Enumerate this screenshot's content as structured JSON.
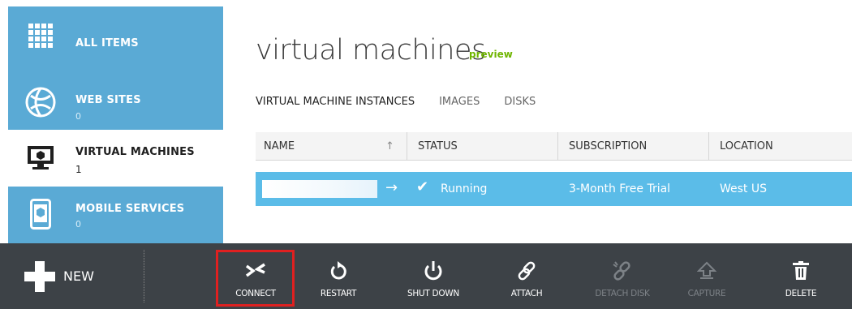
{
  "sidebar": {
    "items": [
      {
        "label": "ALL ITEMS",
        "count": "",
        "icon": "grid-icon"
      },
      {
        "label": "WEB SITES",
        "count": "0",
        "icon": "globe-icon"
      },
      {
        "label": "VIRTUAL MACHINES",
        "count": "1",
        "icon": "monitor-icon"
      },
      {
        "label": "MOBILE SERVICES",
        "count": "0",
        "icon": "mobile-icon"
      }
    ],
    "colors": {
      "nav_bg": "#5aaad5",
      "active_bg": "#ffffff"
    }
  },
  "main": {
    "title": "virtual machines",
    "badge": "preview",
    "tabs": [
      {
        "label": "VIRTUAL MACHINE INSTANCES"
      },
      {
        "label": "IMAGES"
      },
      {
        "label": "DISKS"
      }
    ],
    "grid": {
      "columns": [
        "NAME",
        "STATUS",
        "SUBSCRIPTION",
        "LOCATION"
      ],
      "sort_indicator": "↑",
      "rows": [
        {
          "name": "",
          "status": "Running",
          "subscription": "3-Month Free Trial",
          "location": "West US"
        }
      ]
    }
  },
  "command_bar": {
    "new_label": "NEW",
    "commands": [
      {
        "label": "CONNECT",
        "icon": "connect-icon",
        "enabled": true,
        "highlighted": true
      },
      {
        "label": "RESTART",
        "icon": "restart-icon",
        "enabled": true
      },
      {
        "label": "SHUT DOWN",
        "icon": "power-icon",
        "enabled": true
      },
      {
        "label": "ATTACH",
        "icon": "link-icon",
        "enabled": true
      },
      {
        "label": "DETACH DISK",
        "icon": "unlink-icon",
        "enabled": false
      },
      {
        "label": "CAPTURE",
        "icon": "capture-icon",
        "enabled": false
      },
      {
        "label": "DELETE",
        "icon": "trash-icon",
        "enabled": true
      }
    ],
    "colors": {
      "bg": "#3d4247",
      "highlight": "#e02020"
    }
  }
}
